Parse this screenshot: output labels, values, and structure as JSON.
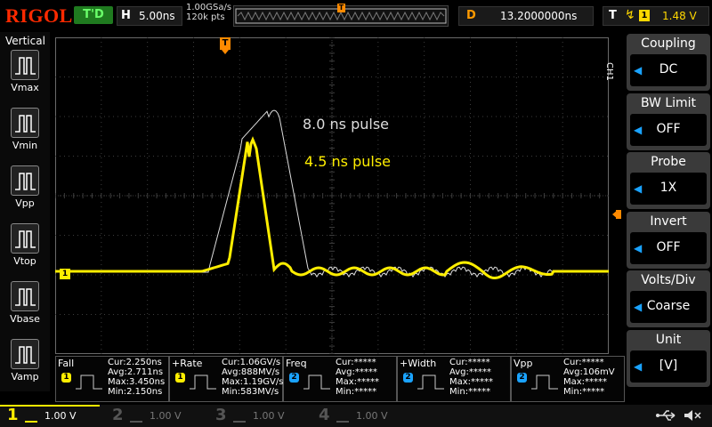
{
  "brand": {
    "logo": "RIGOL"
  },
  "status": {
    "trigger_state": "T'D"
  },
  "horizontal": {
    "key": "H",
    "timebase": "5.00ns",
    "sample_rate": "1.00GSa/s",
    "memory": "120k pts"
  },
  "delay": {
    "key": "D",
    "value": "13.2000000ns"
  },
  "trigger": {
    "key": "T",
    "source": "1",
    "level": "1.48 V",
    "edge_icon": "rising-edge-icon"
  },
  "left_menu": {
    "title": "Vertical",
    "items": [
      {
        "label": "Vmax"
      },
      {
        "label": "Vmin"
      },
      {
        "label": "Vpp"
      },
      {
        "label": "Vtop"
      },
      {
        "label": "Vbase"
      },
      {
        "label": "Vamp"
      }
    ]
  },
  "right_menu": {
    "channel_tag": "CH1",
    "items": [
      {
        "title": "Coupling",
        "value": "DC"
      },
      {
        "title": "BW Limit",
        "value": "OFF"
      },
      {
        "title": "Probe",
        "value": "1X"
      },
      {
        "title": "Invert",
        "value": "OFF"
      },
      {
        "title": "Volts/Div",
        "value": "Coarse"
      },
      {
        "title": "Unit",
        "value": "[V]"
      }
    ]
  },
  "plot": {
    "marker_trigger_pos": "T",
    "marker_ch1": "1",
    "annotations": {
      "white": "8.0 ns pulse",
      "yellow": "4.5 ns pulse"
    }
  },
  "measurements": [
    {
      "name": "Fall",
      "channel": "1",
      "cur": "Cur:2.250ns",
      "avg": "Avg:2.711ns",
      "max": "Max:3.450ns",
      "min": "Min:2.150ns"
    },
    {
      "name": "+Rate",
      "channel": "1",
      "cur": "Cur:1.06GV/s",
      "avg": "Avg:888MV/s",
      "max": "Max:1.19GV/s",
      "min": "Min:583MV/s"
    },
    {
      "name": "Freq",
      "channel": "2",
      "cur": "Cur:*****",
      "avg": "Avg:*****",
      "max": "Max:*****",
      "min": "Min:*****"
    },
    {
      "name": "+Width",
      "channel": "2",
      "cur": "Cur:*****",
      "avg": "Avg:*****",
      "max": "Max:*****",
      "min": "Min:*****"
    },
    {
      "name": "Vpp",
      "channel": "2",
      "cur": "Cur:*****",
      "avg": "Avg:106mV",
      "max": "Max:*****",
      "min": "Min:*****"
    }
  ],
  "channels": [
    {
      "num": "1",
      "scale": "1.00 V",
      "color": "#ffee00",
      "active": true
    },
    {
      "num": "2",
      "scale": "1.00 V",
      "color": "#1aa3ff",
      "active": false
    },
    {
      "num": "3",
      "scale": "1.00 V",
      "color": "#ff00ff",
      "active": false
    },
    {
      "num": "4",
      "scale": "1.00 V",
      "color": "#4aa3ff",
      "active": false
    }
  ],
  "colors": {
    "ch1": "#ffee00",
    "ref": "#dddddd",
    "trigger": "#ff8a00",
    "grid": "#3c3c3c",
    "accent": "#1aa3ff"
  },
  "icons": {
    "usb": "usb-icon",
    "speaker": "speaker-muted-icon"
  }
}
